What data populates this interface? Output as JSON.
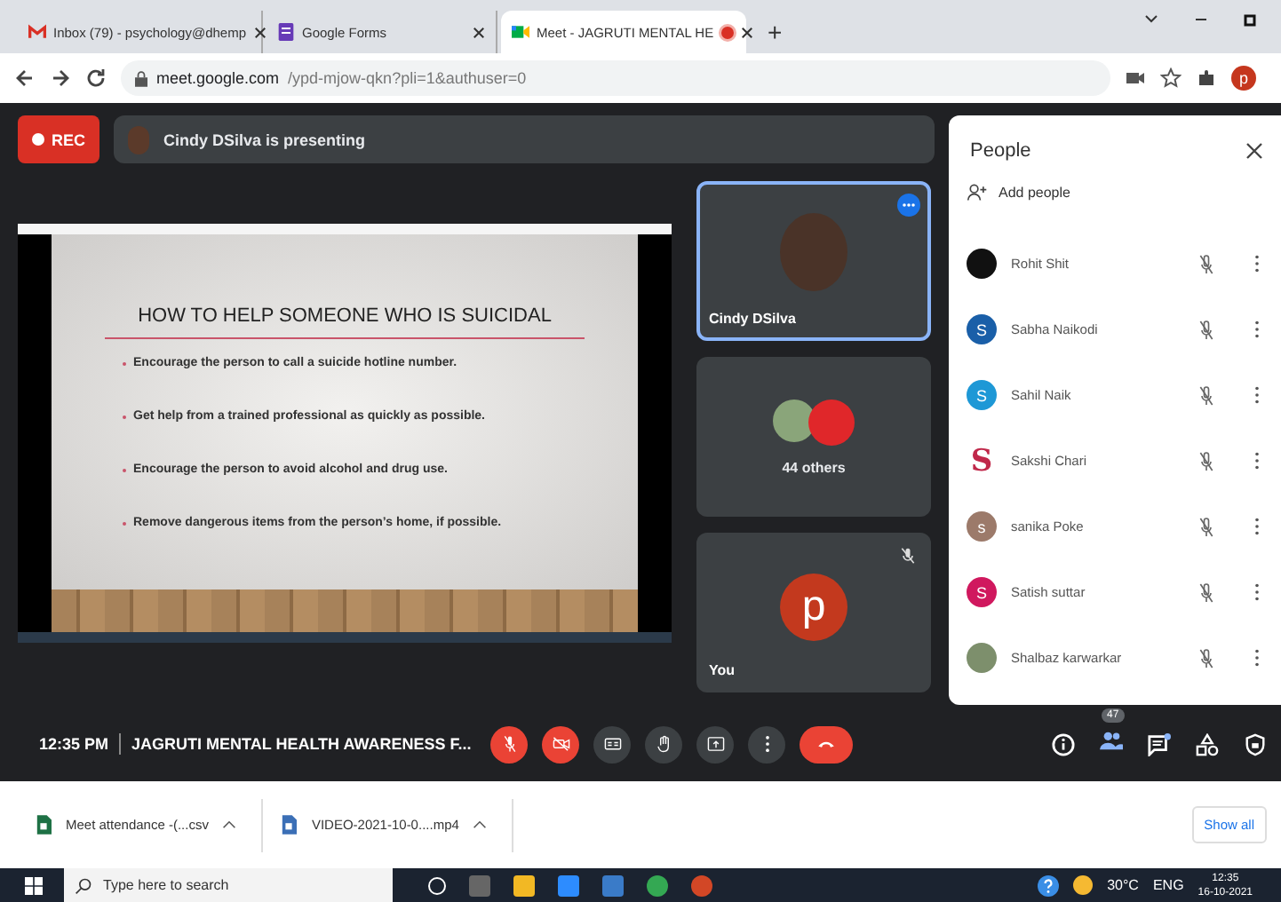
{
  "browser": {
    "tabs": [
      {
        "kind": "gmail",
        "title": "Inbox (79) - psychology@dhemp",
        "selected": false,
        "recording": false
      },
      {
        "kind": "forms",
        "title": "Google Forms",
        "selected": false,
        "recording": false
      },
      {
        "kind": "meet",
        "title": "Meet - JAGRUTI MENTAL HE",
        "selected": true,
        "recording": true
      }
    ],
    "new_tab": "+",
    "url_host": "meet.google.com",
    "url_path": "/ypd-mjow-qkn?pli=1&authuser=0",
    "profile_letter": "p"
  },
  "meeting": {
    "rec": "REC",
    "presenting": "Cindy DSilva is presenting",
    "slide": {
      "title": "HOW TO HELP SOMEONE WHO IS SUICIDAL",
      "bullets": [
        "Encourage the person to call a suicide hotline number.",
        "Get help from a trained professional as quickly as possible.",
        "Encourage the person to avoid alcohol and drug use.",
        "Remove dangerous items from the person’s home, if possible."
      ]
    },
    "tiles": [
      {
        "kind": "speaker",
        "name": "Cindy DSilva",
        "selected": true
      },
      {
        "kind": "group",
        "name": "44 others",
        "selected": false
      },
      {
        "kind": "self",
        "name": "You",
        "letter": "p",
        "selected": false
      }
    ],
    "time": "12:35 PM",
    "title": "JAGRUTI MENTAL HEALTH AWARENESS F...",
    "controls": [
      {
        "kind": "mic",
        "off": true
      },
      {
        "kind": "camera",
        "off": true
      },
      {
        "kind": "captions"
      },
      {
        "kind": "hand"
      },
      {
        "kind": "present"
      },
      {
        "kind": "more"
      },
      {
        "kind": "end"
      }
    ],
    "people_count": "47"
  },
  "people": {
    "title": "People",
    "add": "Add people",
    "participants": [
      {
        "name": "Rohit Shit",
        "kind": "photo",
        "color": "#111111",
        "muted": true
      },
      {
        "name": "Sabha Naikodi",
        "kind": "letter",
        "letter": "S",
        "color": "#1a5fa8",
        "muted": true
      },
      {
        "name": "Sahil Naik",
        "kind": "letter",
        "letter": "S",
        "color": "#1e98d6",
        "muted": true
      },
      {
        "name": "Sakshi Chari",
        "kind": "logo",
        "letter": "S",
        "color": "#c0284a",
        "muted": true
      },
      {
        "name": "sanika Poke",
        "kind": "letter",
        "letter": "s",
        "color": "#9c7a6a",
        "muted": true
      },
      {
        "name": "Satish suttar",
        "kind": "letter",
        "letter": "S",
        "color": "#d0185e",
        "muted": true
      },
      {
        "name": "Shalbaz karwarkar",
        "kind": "photo",
        "color": "#7d8f6c",
        "muted": true
      }
    ]
  },
  "downloads": {
    "items": [
      "Meet attendance -(...csv",
      "VIDEO-2021-10-0....mp4"
    ],
    "show_all": "Show all"
  },
  "taskbar": {
    "search": "Type here to search",
    "weather": "30°C",
    "lang": "ENG",
    "time": "12:35",
    "date": "16-10-2021"
  }
}
